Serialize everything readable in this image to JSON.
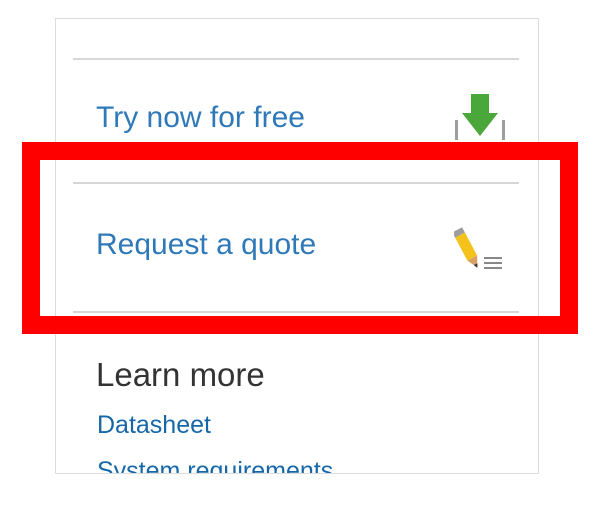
{
  "actions": [
    {
      "label": "Try now for free",
      "icon": "download-arrow-icon"
    },
    {
      "label": "Request a quote",
      "icon": "pencil-notes-icon"
    }
  ],
  "learn_more": {
    "heading": "Learn more",
    "links": [
      "Datasheet",
      "System requirements"
    ]
  },
  "colors": {
    "link": "#2f79b9",
    "highlight": "#ff0000",
    "download_green": "#4aa83a",
    "pencil_yellow": "#f4c21a"
  }
}
